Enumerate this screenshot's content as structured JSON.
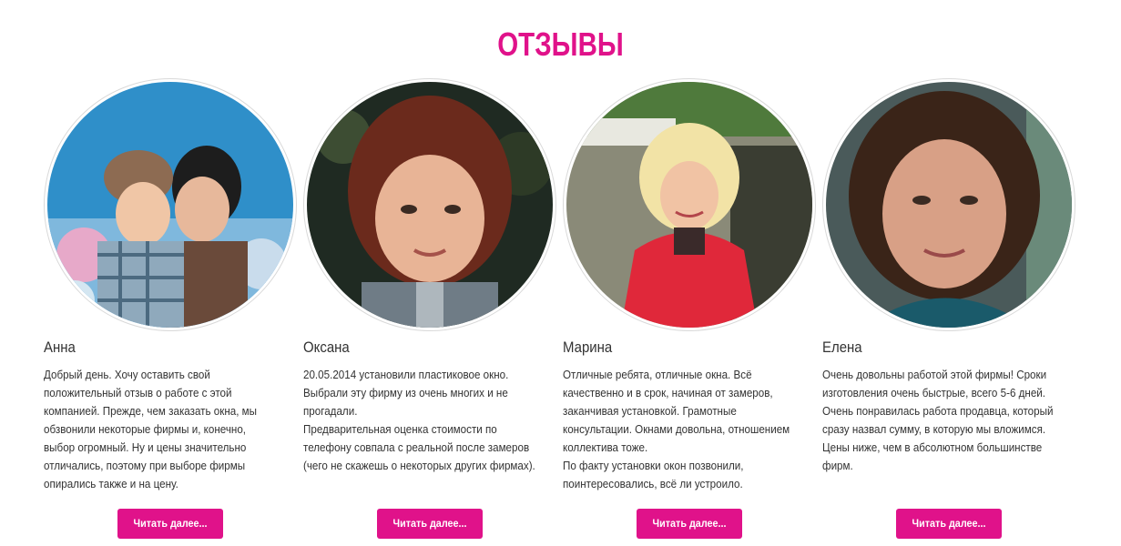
{
  "section": {
    "title": "ОТЗЫВЫ",
    "accent_color": "#e0128a"
  },
  "reviews": [
    {
      "name": "Анна",
      "photo": "photo-anna",
      "text": "Добрый день. Хочу оставить свой\nположительный отзыв о работе с этой\nкомпанией. Прежде, чем заказать окна, мы\nобзвонили некоторые фирмы и, конечно,\nвыбор огромный. Ну и цены значительно\nотличались, поэтому при выборе фирмы\nопирались также и на цену.",
      "button": "Читать далее..."
    },
    {
      "name": "Оксана",
      "photo": "photo-oksana",
      "text": "20.05.2014 установили пластиковое окно.\nВыбрали эту фирму из очень многих и не\nпрогадали.\nПредварительная оценка стоимости по\nтелефону совпала с реальной после замеров\n(чего не скажешь о некоторых других фирмах).",
      "button": "Читать далее..."
    },
    {
      "name": "Марина",
      "photo": "photo-marina",
      "text": "Отличные ребята, отличные окна. Всё\nкачественно и в срок, начиная от замеров,\nзаканчивая установкой. Грамотные\nконсультации. Окнами довольна, отношением\nколлектива тоже.\nПо факту установки окон позвонили,\nпоинтересовались, всё ли устроило.",
      "button": "Читать далее..."
    },
    {
      "name": "Елена",
      "photo": "photo-elena",
      "text": "Очень довольны работой этой фирмы! Сроки\nизготовления очень быстрые, всего 5-6 дней.\nОчень понравилась работа продавца, который\nсразу назвал сумму, в которую мы вложимся.\nЦены ниже, чем в абсолютном большинстве\nфирм.",
      "button": "Читать далее..."
    }
  ]
}
